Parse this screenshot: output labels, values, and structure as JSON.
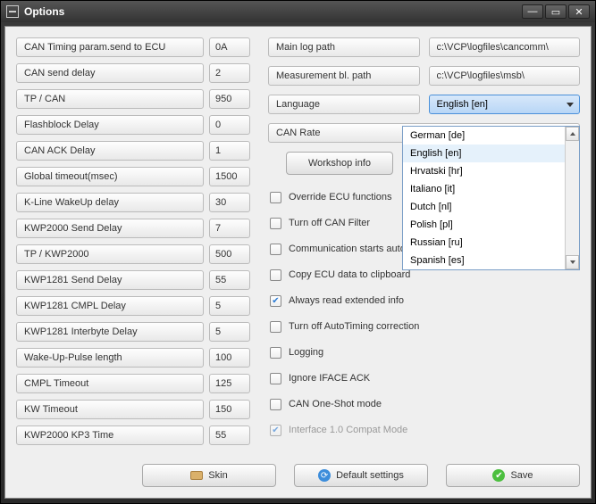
{
  "window": {
    "title": "Options"
  },
  "params": [
    {
      "label": "CAN Timing param.send to ECU",
      "value": "0A"
    },
    {
      "label": "CAN send delay",
      "value": "2"
    },
    {
      "label": "TP / CAN",
      "value": "950"
    },
    {
      "label": "Flashblock Delay",
      "value": "0"
    },
    {
      "label": "CAN ACK Delay",
      "value": "1"
    },
    {
      "label": "Global timeout(msec)",
      "value": "1500"
    },
    {
      "label": "K-Line WakeUp delay",
      "value": "30"
    },
    {
      "label": "KWP2000 Send Delay",
      "value": "7"
    },
    {
      "label": "TP / KWP2000",
      "value": "500"
    },
    {
      "label": "KWP1281 Send Delay",
      "value": "55"
    },
    {
      "label": "KWP1281 CMPL Delay",
      "value": "5"
    },
    {
      "label": "KWP1281 Interbyte Delay",
      "value": "5"
    },
    {
      "label": "Wake-Up-Pulse length",
      "value": "100"
    },
    {
      "label": "CMPL Timeout",
      "value": "125"
    },
    {
      "label": "KW Timeout",
      "value": "150"
    },
    {
      "label": "KWP2000 KP3 Time",
      "value": "55"
    }
  ],
  "paths": {
    "main_log_label": "Main log path",
    "main_log_value": "c:\\VCP\\logfiles\\cancomm\\",
    "meas_label": "Measurement bl. path",
    "meas_value": "c:\\VCP\\logfiles\\msb\\"
  },
  "language": {
    "label": "Language",
    "value": "English [en]"
  },
  "can_rate": {
    "label": "CAN Rate"
  },
  "workshop_btn": "Workshop info",
  "language_options": [
    "German [de]",
    "English [en]",
    "Hrvatski [hr]",
    "Italiano [it]",
    "Dutch [nl]",
    "Polish [pl]",
    "Russian [ru]",
    "Spanish [es]"
  ],
  "checkboxes": [
    {
      "label": "Override ECU functions",
      "checked": false
    },
    {
      "label": "Turn off CAN Filter",
      "checked": false
    },
    {
      "label": "Communication starts automatically",
      "checked": false
    },
    {
      "label": "Copy ECU data to clipboard",
      "checked": false
    },
    {
      "label": "Always read extended info",
      "checked": true
    },
    {
      "label": "Turn off AutoTiming correction",
      "checked": false
    },
    {
      "label": "Logging",
      "checked": false
    },
    {
      "label": "Ignore IFACE ACK",
      "checked": false
    },
    {
      "label": "CAN One-Shot mode",
      "checked": false
    },
    {
      "label": "Interface 1.0 Compat Mode",
      "checked": true,
      "disabled": true
    }
  ],
  "buttons": {
    "skin": "Skin",
    "defaults": "Default settings",
    "save": "Save"
  }
}
